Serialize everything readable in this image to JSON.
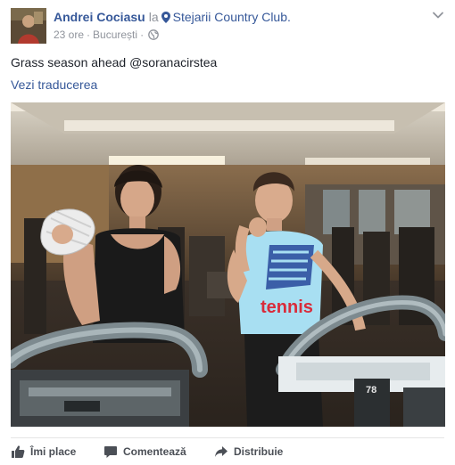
{
  "post": {
    "author": "Andrei Cociasu",
    "at_word": "la",
    "place": "Stejarii Country Club.",
    "time": "23 ore",
    "separator": "·",
    "location": "București",
    "text": "Grass season ahead @soranacirstea",
    "translate_label": "Vezi traducerea"
  },
  "photo": {
    "shirt_brand": "NB",
    "shirt_word": "tennis",
    "machine_number": "78"
  },
  "actions": {
    "like": "Îmi place",
    "comment": "Comentează",
    "share": "Distribuie"
  },
  "icons": {
    "location": "map-pin-icon",
    "audience": "globe-icon",
    "menu": "chevron-down-icon",
    "like": "thumbs-up-icon",
    "comment": "speech-bubble-icon",
    "share": "share-arrow-icon"
  },
  "colors": {
    "link": "#365899",
    "muted": "#90949c",
    "text": "#1d2129",
    "action": "#4b4f56"
  }
}
